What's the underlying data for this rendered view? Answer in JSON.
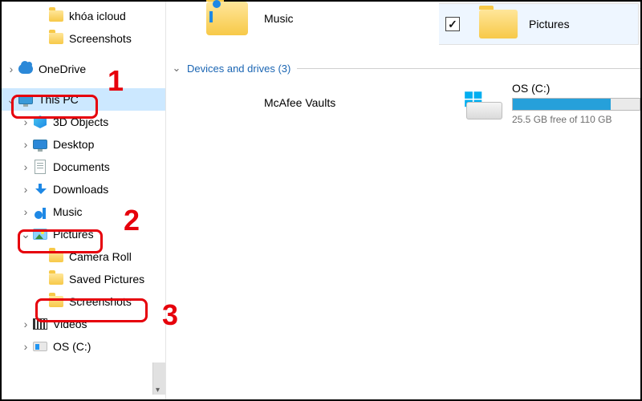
{
  "sidebar": {
    "items": [
      {
        "label": "khóa icloud",
        "icon": "folder"
      },
      {
        "label": "Screenshots",
        "icon": "folder"
      },
      {
        "label": "OneDrive",
        "icon": "onedrive"
      },
      {
        "label": "This PC",
        "icon": "this-pc"
      },
      {
        "label": "3D Objects",
        "icon": "3d"
      },
      {
        "label": "Desktop",
        "icon": "desktop"
      },
      {
        "label": "Documents",
        "icon": "documents"
      },
      {
        "label": "Downloads",
        "icon": "downloads"
      },
      {
        "label": "Music",
        "icon": "music"
      },
      {
        "label": "Pictures",
        "icon": "pictures"
      },
      {
        "label": "Camera Roll",
        "icon": "folder"
      },
      {
        "label": "Saved Pictures",
        "icon": "folder"
      },
      {
        "label": "Screenshots",
        "icon": "folder"
      },
      {
        "label": "Videos",
        "icon": "videos"
      },
      {
        "label": "OS (C:)",
        "icon": "drive"
      }
    ]
  },
  "main": {
    "top_folder_label": "Music",
    "section_header": "Devices and drives (3)",
    "mcafee_label": "McAfee Vaults",
    "drive": {
      "title": "OS (C:)",
      "free_text": "25.5 GB free of 110 GB",
      "fill_percent": 77
    },
    "thumbnail_label": "Pictures",
    "checkbox_checked": true
  },
  "annotations": {
    "n1": "1",
    "n2": "2",
    "n3": "3"
  },
  "glyphs": {
    "chev_right": "›",
    "chev_down": "⌄",
    "check": "✓"
  },
  "colors": {
    "annotation": "#e6000b",
    "selection": "#cce8ff",
    "drive_bar": "#26a0da"
  }
}
